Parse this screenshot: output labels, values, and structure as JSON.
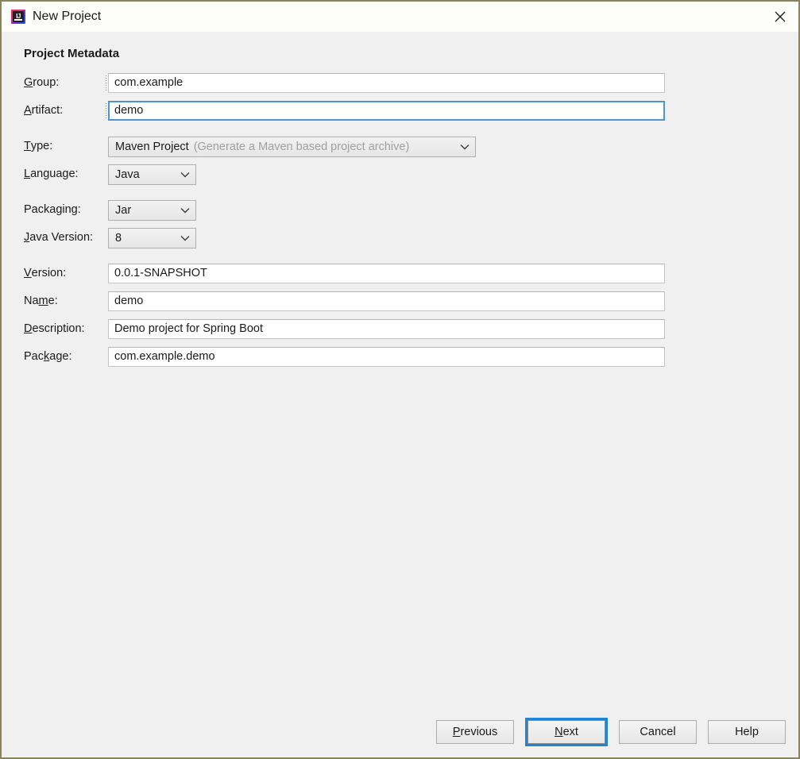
{
  "window": {
    "title": "New Project",
    "app_icon": "intellij-idea-icon",
    "close_icon": "close-icon",
    "border_color": "#8a8459",
    "titlebar_bg": "#fdfdfa",
    "dialog_bg": "#f0f0f0"
  },
  "section": {
    "title": "Project Metadata"
  },
  "fields": {
    "group": {
      "label_pre": "",
      "label_mn": "G",
      "label_post": "roup:",
      "value": "com.example",
      "type": "text",
      "focused": false
    },
    "artifact": {
      "label_pre": "",
      "label_mn": "A",
      "label_post": "rtifact:",
      "value": "demo",
      "type": "text",
      "focused": true
    },
    "project_type": {
      "label_pre": "",
      "label_mn": "T",
      "label_post": "ype:",
      "value": "Maven Project",
      "hint": "(Generate a Maven based project archive)",
      "type": "combobox",
      "arrow_icon": "chevron-down-icon"
    },
    "language": {
      "label_pre": "",
      "label_mn": "L",
      "label_post": "anguage:",
      "value": "Java",
      "type": "combobox",
      "arrow_icon": "chevron-down-icon"
    },
    "packaging": {
      "label_pre": "Packa",
      "label_mn": "g",
      "label_post": "ing:",
      "value": "Jar",
      "type": "combobox",
      "arrow_icon": "chevron-down-icon"
    },
    "java_version": {
      "label_pre": "",
      "label_mn": "J",
      "label_post": "ava Version:",
      "value": "8",
      "type": "combobox",
      "arrow_icon": "chevron-down-icon"
    },
    "version": {
      "label_pre": "",
      "label_mn": "V",
      "label_post": "ersion:",
      "value": "0.0.1-SNAPSHOT",
      "type": "text",
      "focused": false
    },
    "name": {
      "label_pre": "Na",
      "label_mn": "m",
      "label_post": "e:",
      "value": "demo",
      "type": "text",
      "focused": false
    },
    "description": {
      "label_pre": "",
      "label_mn": "D",
      "label_post": "escription:",
      "value": "Demo project for Spring Boot",
      "type": "text",
      "focused": false
    },
    "package": {
      "label_pre": "Pac",
      "label_mn": "k",
      "label_post": "age:",
      "value": "com.example.demo",
      "type": "text",
      "focused": false
    }
  },
  "buttons": {
    "previous": {
      "pre": "",
      "mn": "P",
      "post": "revious",
      "focused": false
    },
    "next": {
      "pre": "",
      "mn": "N",
      "post": "ext",
      "focused": true
    },
    "cancel": {
      "pre": "Cancel",
      "mn": "",
      "post": "",
      "focused": false
    },
    "help": {
      "pre": "Help",
      "mn": "",
      "post": "",
      "focused": false
    }
  },
  "colors": {
    "focus_ring": "#1e84d6",
    "focused_input_border": "#4c95d1",
    "hint_text": "#a0a0a0",
    "text": "#1a1a1a"
  }
}
